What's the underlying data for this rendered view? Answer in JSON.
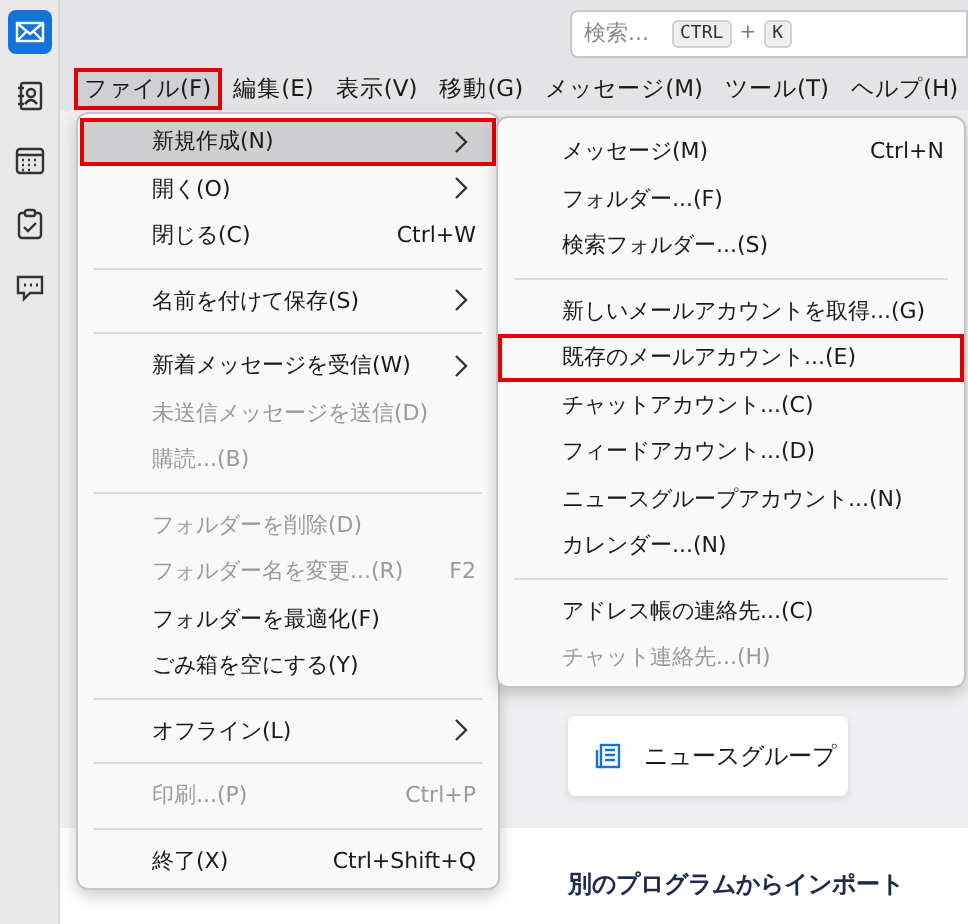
{
  "sidebar": {
    "items": [
      {
        "kind": "mail",
        "selected": true
      },
      {
        "kind": "contacts",
        "selected": false
      },
      {
        "kind": "calendar",
        "selected": false
      },
      {
        "kind": "tasks",
        "selected": false
      },
      {
        "kind": "chat",
        "selected": false
      }
    ]
  },
  "search": {
    "placeholder": "検索...",
    "keys": [
      "CTRL",
      "K"
    ],
    "joiner": "+"
  },
  "menubar": [
    {
      "label": "ファイル(F)",
      "selected": true,
      "highlighted": true
    },
    {
      "label": "編集(E)",
      "selected": false,
      "highlighted": false
    },
    {
      "label": "表示(V)",
      "selected": false,
      "highlighted": false
    },
    {
      "label": "移動(G)",
      "selected": false,
      "highlighted": false
    },
    {
      "label": "メッセージ(M)",
      "selected": false,
      "highlighted": false
    },
    {
      "label": "ツール(T)",
      "selected": false,
      "highlighted": false
    },
    {
      "label": "ヘルプ(H)",
      "selected": false,
      "highlighted": false
    }
  ],
  "file_menu": [
    {
      "kind": "item",
      "label": "新規作成(N)",
      "submenu": true,
      "disabled": false,
      "selected": true,
      "highlighted": true
    },
    {
      "kind": "item",
      "label": "開く(O)",
      "submenu": true,
      "disabled": false,
      "selected": false,
      "highlighted": false
    },
    {
      "kind": "item",
      "label": "閉じる(C)",
      "shortcut": "Ctrl+W",
      "disabled": false,
      "selected": false,
      "highlighted": false
    },
    {
      "kind": "separator"
    },
    {
      "kind": "item",
      "label": "名前を付けて保存(S)",
      "submenu": true,
      "disabled": false,
      "selected": false,
      "highlighted": false
    },
    {
      "kind": "separator"
    },
    {
      "kind": "item",
      "label": "新着メッセージを受信(W)",
      "submenu": true,
      "disabled": false,
      "selected": false,
      "highlighted": false
    },
    {
      "kind": "item",
      "label": "未送信メッセージを送信(D)",
      "disabled": true,
      "selected": false,
      "highlighted": false
    },
    {
      "kind": "item",
      "label": "購読...(B)",
      "disabled": true,
      "selected": false,
      "highlighted": false
    },
    {
      "kind": "separator"
    },
    {
      "kind": "item",
      "label": "フォルダーを削除(D)",
      "disabled": true,
      "selected": false,
      "highlighted": false
    },
    {
      "kind": "item",
      "label": "フォルダー名を変更...(R)",
      "shortcut": "F2",
      "disabled": true,
      "selected": false,
      "highlighted": false
    },
    {
      "kind": "item",
      "label": "フォルダーを最適化(F)",
      "disabled": false,
      "selected": false,
      "highlighted": false
    },
    {
      "kind": "item",
      "label": "ごみ箱を空にする(Y)",
      "disabled": false,
      "selected": false,
      "highlighted": false
    },
    {
      "kind": "separator"
    },
    {
      "kind": "item",
      "label": "オフライン(L)",
      "submenu": true,
      "disabled": false,
      "selected": false,
      "highlighted": false
    },
    {
      "kind": "separator"
    },
    {
      "kind": "item",
      "label": "印刷...(P)",
      "shortcut": "Ctrl+P",
      "disabled": true,
      "selected": false,
      "highlighted": false
    },
    {
      "kind": "separator"
    },
    {
      "kind": "item",
      "label": "終了(X)",
      "shortcut": "Ctrl+Shift+Q",
      "disabled": false,
      "selected": false,
      "highlighted": false
    }
  ],
  "new_submenu": [
    {
      "kind": "item",
      "label": "メッセージ(M)",
      "shortcut": "Ctrl+N",
      "disabled": false,
      "selected": false,
      "highlighted": false
    },
    {
      "kind": "item",
      "label": "フォルダー...(F)",
      "disabled": false,
      "selected": false,
      "highlighted": false
    },
    {
      "kind": "item",
      "label": "検索フォルダー...(S)",
      "disabled": false,
      "selected": false,
      "highlighted": false
    },
    {
      "kind": "separator"
    },
    {
      "kind": "item",
      "label": "新しいメールアカウントを取得...(G)",
      "disabled": false,
      "selected": false,
      "highlighted": false
    },
    {
      "kind": "item",
      "label": "既存のメールアカウント...(E)",
      "disabled": false,
      "selected": false,
      "highlighted": true
    },
    {
      "kind": "item",
      "label": "チャットアカウント...(C)",
      "disabled": false,
      "selected": false,
      "highlighted": false
    },
    {
      "kind": "item",
      "label": "フィードアカウント...(D)",
      "disabled": false,
      "selected": false,
      "highlighted": false
    },
    {
      "kind": "item",
      "label": "ニュースグループアカウント...(N)",
      "disabled": false,
      "selected": false,
      "highlighted": false
    },
    {
      "kind": "item",
      "label": "カレンダー...(N)",
      "disabled": false,
      "selected": false,
      "highlighted": false
    },
    {
      "kind": "separator"
    },
    {
      "kind": "item",
      "label": "アドレス帳の連絡先...(C)",
      "disabled": false,
      "selected": false,
      "highlighted": false
    },
    {
      "kind": "item",
      "label": "チャット連絡先...(H)",
      "disabled": true,
      "selected": false,
      "highlighted": false
    }
  ],
  "content": {
    "card": {
      "label": "ニュースグループ"
    },
    "heading": "別のプログラムからインポート"
  }
}
